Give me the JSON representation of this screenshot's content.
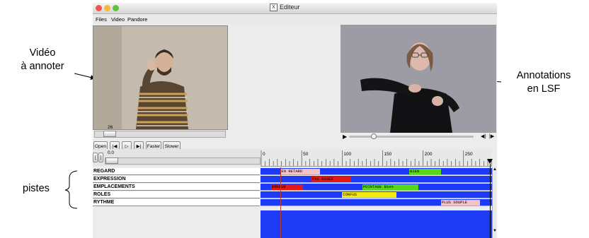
{
  "annotations": {
    "video_to_annotate": [
      "Vidéo",
      "à annoter"
    ],
    "lsf_annotations": [
      "Annotations",
      "en LSF"
    ],
    "tracks": "pistes"
  },
  "window": {
    "title": "Editeur",
    "title_icon": "X"
  },
  "menu": [
    "Files",
    "Video",
    "Pandore"
  ],
  "player1": {
    "position_value": "26",
    "buttons": {
      "open": "Open",
      "faster": "Faster",
      "slower": "Slower"
    }
  },
  "timeline": {
    "zoom_value": "0.0",
    "bracket_left": "[",
    "bracket_right": "]",
    "ticks": [
      "0",
      "50",
      "100",
      "150",
      "200",
      "250"
    ],
    "tracks": [
      {
        "name": "REGARD",
        "segments": [
          {
            "label": "EN RETARD",
            "start": 24,
            "end": 73,
            "color": "#f4c3c9"
          },
          {
            "label": "BIEN",
            "start": 183,
            "end": 222,
            "color": "#58d61c"
          }
        ]
      },
      {
        "name": "EXPRESSION",
        "segments": [
          {
            "label": "PAS ASSEZ",
            "start": 62,
            "end": 111,
            "color": "#e01818"
          }
        ]
      },
      {
        "name": "EMPLACEMENTS",
        "segments": [
          {
            "label": "ERREUR",
            "start": 12,
            "end": 52,
            "color": "#e01818"
          },
          {
            "label": "POINTAGE Bien",
            "start": 125,
            "end": 194,
            "color": "#58d61c"
          }
        ]
      },
      {
        "name": "ROLES",
        "segments": [
          {
            "label": "CONFUS",
            "start": 100,
            "end": 167,
            "color": "#f4ec10"
          }
        ]
      },
      {
        "name": "RYTHME",
        "segments": [
          {
            "label": "PLUS SOUPLE",
            "start": 222,
            "end": 270,
            "color": "#f4c3c9"
          }
        ]
      }
    ]
  },
  "colors": {
    "lane": "#1d3bf5",
    "close_button": "#f2564d",
    "minimize_button": "#f6b73a",
    "zoom_button": "#5fc13d"
  }
}
